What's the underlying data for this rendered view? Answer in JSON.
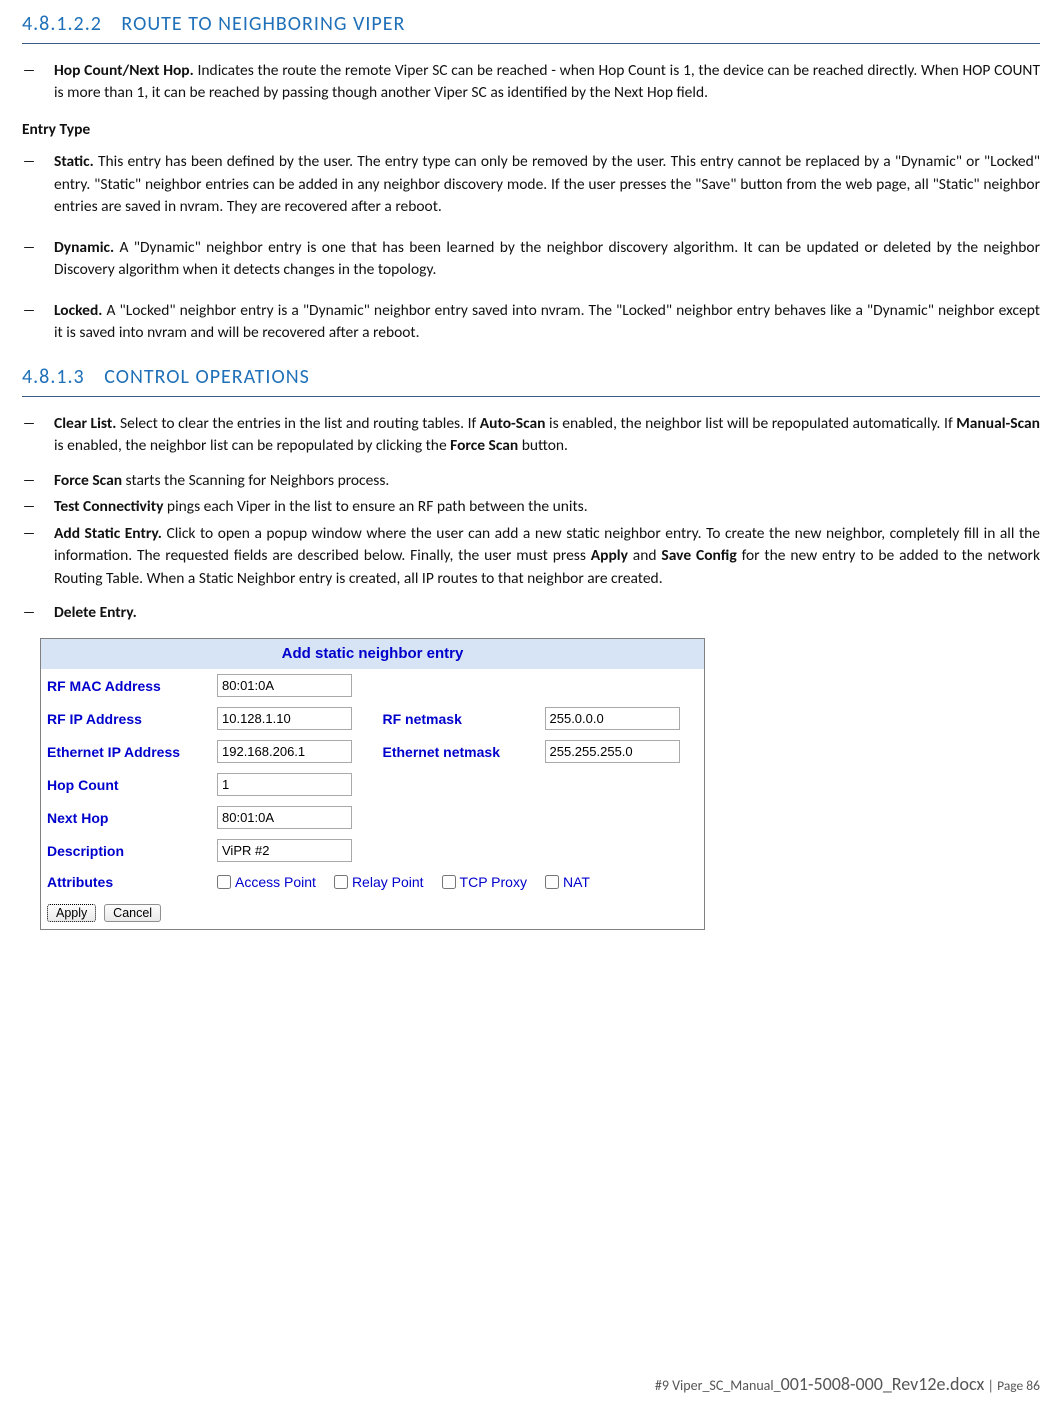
{
  "sections": {
    "s1": {
      "num": "4.8.1.2.2",
      "title": "ROUTE TO NEIGHBORING VIPER"
    },
    "s2": {
      "num": "4.8.1.3",
      "title": "CONTROL OPERATIONS"
    }
  },
  "s1_items": {
    "hop": {
      "label": "Hop Count/Next Hop.",
      "text": "Indicates the route the remote Viper SC can be reached - when Hop Count is 1, the device can be reached directly. When HOP COUNT is more than 1, it can be reached by passing though another Viper SC as identified by the Next Hop field."
    }
  },
  "entry_type_label": "Entry Type",
  "entry_types": {
    "static": {
      "label": "Static.",
      "text": "This entry has been defined by the user. The entry type can only be removed by the user. This entry cannot be replaced by a \"Dynamic\" or \"Locked\" entry. \"Static\" neighbor entries can be added in any neighbor discovery mode. If the user presses the \"Save\" button from the web page, all \"Static\" neighbor entries are saved in nvram. They are recovered after a reboot."
    },
    "dynamic": {
      "label": "Dynamic.",
      "text": "A \"Dynamic\" neighbor entry is one that has been learned by the neighbor discovery algorithm. It can be updated or deleted by the neighbor Discovery algorithm when it detects changes in the topology."
    },
    "locked": {
      "label": "Locked.",
      "text": "A \"Locked\" neighbor entry is a \"Dynamic\" neighbor entry saved into nvram. The \"Locked\" neighbor entry behaves like a \"Dynamic\" neighbor except it is saved into nvram and will be recovered after a reboot."
    }
  },
  "s2_items": {
    "clear": {
      "label": "Clear List.",
      "t1": "Select to clear the entries in the list and routing tables. If ",
      "b1": "Auto-Scan",
      "t2": " is enabled, the neighbor list will be repopulated automatically. If ",
      "b2": "Manual-Scan",
      "t3": " is enabled, the neighbor list can be repopulated by clicking the ",
      "b3": "Force Scan",
      "t4": " button."
    },
    "force": {
      "label": "Force Scan",
      "text": " starts the Scanning for Neighbors process."
    },
    "test": {
      "label": "Test Connectivity",
      "text": " pings each Viper in the list to ensure an RF path between the units."
    },
    "add": {
      "label": "Add Static Entry.",
      "t1": " Click to open a popup window where the user can add a new static neighbor entry. To create the new neighbor, completely fill in all the information. The requested fields are described below. Finally, the user must press ",
      "b1": "Apply",
      "t2": " and ",
      "b2": "Save Config",
      "t3": " for the new entry to be added to the network Routing Table. When a Static Neighbor entry is created, all IP routes to that neighbor are created."
    },
    "del": {
      "label": "Delete Entry."
    }
  },
  "dialog": {
    "title": "Add static neighbor entry",
    "labels": {
      "rf_mac": "RF MAC Address",
      "rf_ip": "RF IP Address",
      "rf_netmask": "RF netmask",
      "eth_ip": "Ethernet IP Address",
      "eth_netmask": "Ethernet netmask",
      "hop": "Hop Count",
      "next": "Next Hop",
      "desc": "Description",
      "attr": "Attributes"
    },
    "values": {
      "rf_mac": "80:01:0A",
      "rf_ip": "10.128.1.10",
      "rf_netmask": "255.0.0.0",
      "eth_ip": "192.168.206.1",
      "eth_netmask": "255.255.255.0",
      "hop": "1",
      "next": "80:01:0A",
      "desc": "ViPR #2"
    },
    "attributes": {
      "ap": "Access Point",
      "relay": "Relay Point",
      "tcp": "TCP Proxy",
      "nat": "NAT"
    },
    "buttons": {
      "apply": "Apply",
      "cancel": "Cancel"
    }
  },
  "footer": {
    "prefix": "#9 Viper_SC_Manual_",
    "filename": "001-5008-000_Rev12e.docx",
    "sep": " | ",
    "pagelabel": "Page 86"
  }
}
